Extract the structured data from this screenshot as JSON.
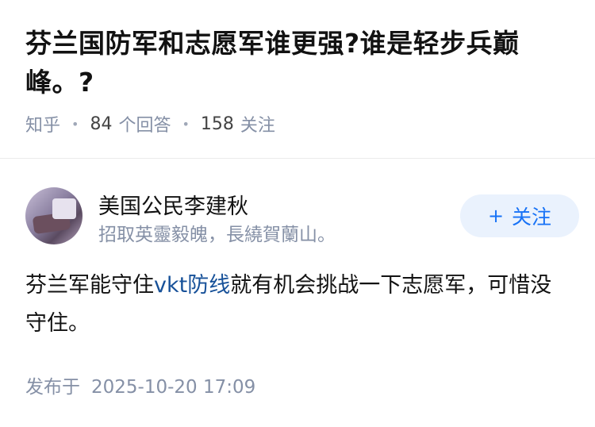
{
  "question": {
    "title": "芬兰国防军和志愿军谁更强?谁是轻步兵巅峰。?",
    "source": "知乎",
    "answer_count": "84",
    "answer_label": "个回答",
    "follow_count": "158",
    "follow_label": "关注"
  },
  "answer": {
    "author": {
      "name": "美国公民李建秋",
      "bio": "招取英靈毅魄，長繞賀蘭山。",
      "follow_button": {
        "icon": "plus-icon",
        "label": "关注"
      }
    },
    "content": {
      "before_link": "芬兰军能守住",
      "link_text": "vkt防线",
      "after_link": "就有机会挑战一下志愿军，可惜没守住。"
    },
    "published_label": "发布于",
    "published_time": "2025-10-20 17:09"
  },
  "colors": {
    "accent": "#1772f6",
    "link": "#175199",
    "meta": "#8590a6",
    "follow_bg": "#eaf2fd"
  }
}
